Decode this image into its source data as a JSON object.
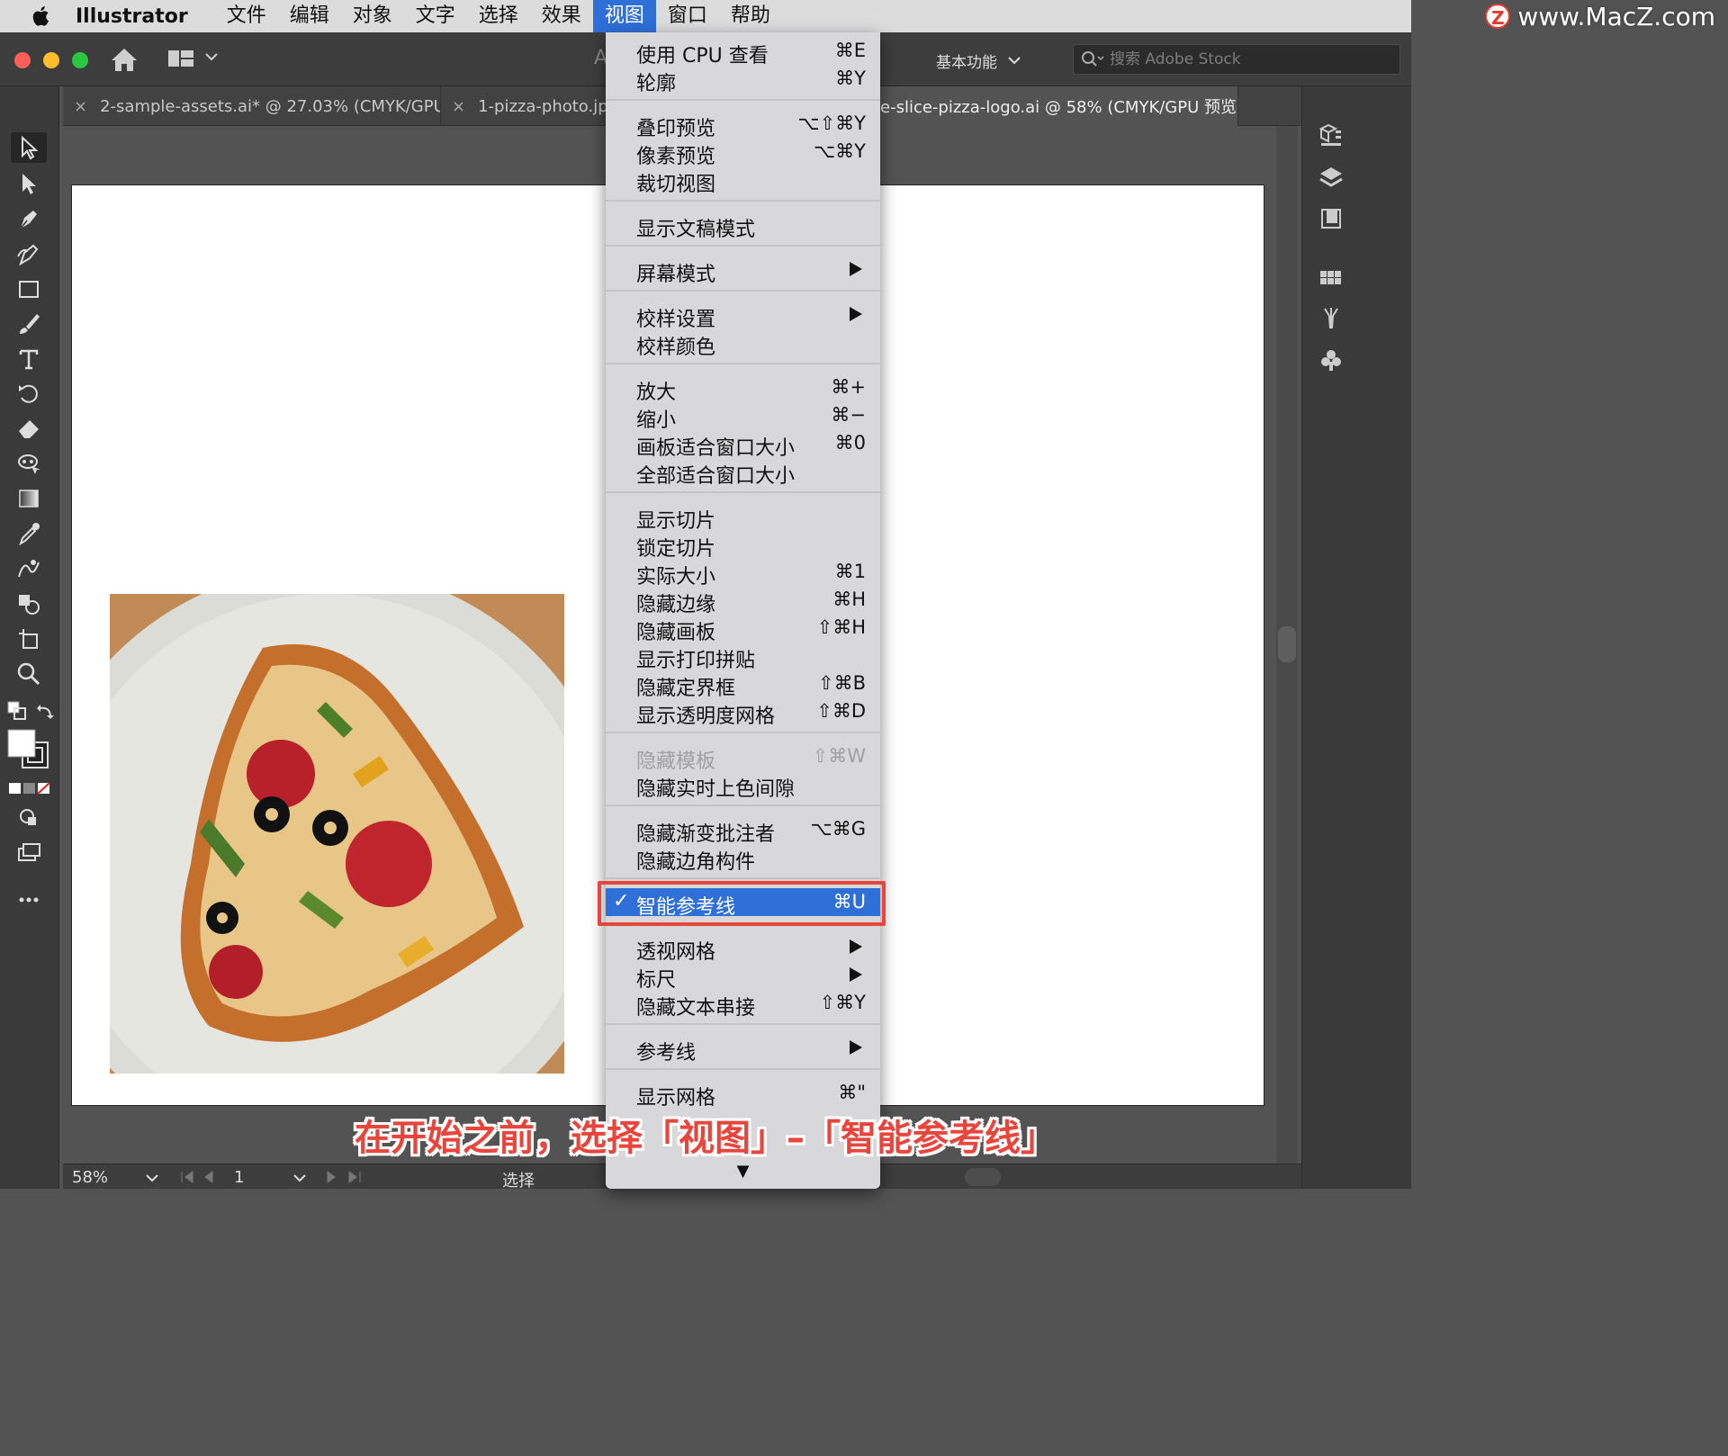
{
  "menubar": {
    "app_name": "Illustrator",
    "items": [
      "文件",
      "编辑",
      "对象",
      "文字",
      "选择",
      "效果",
      "视图",
      "窗口",
      "帮助"
    ],
    "active_index": 6
  },
  "watermark": {
    "letter": "Z",
    "url": "www.MacZ.com"
  },
  "appbar": {
    "workspace": "基本功能",
    "search_placeholder": "搜索 Adobe Stock",
    "partial_title": "A"
  },
  "tabs": [
    {
      "label": "2-sample-assets.ai* @ 27.03% (CMYK/GPU..."
    },
    {
      "label": "1-pizza-photo.jpg"
    },
    {
      "label": "e-slice-pizza-logo.ai @ 58% (CMYK/GPU 预览)"
    }
  ],
  "view_menu": {
    "groups": [
      [
        {
          "label": "使用 CPU 查看",
          "shortcut": "⌘E"
        },
        {
          "label": "轮廓",
          "shortcut": "⌘Y"
        }
      ],
      [
        {
          "label": "叠印预览",
          "shortcut": "⌥⇧⌘Y"
        },
        {
          "label": "像素预览",
          "shortcut": "⌥⌘Y"
        },
        {
          "label": "裁切视图",
          "shortcut": ""
        }
      ],
      [
        {
          "label": "显示文稿模式",
          "shortcut": ""
        }
      ],
      [
        {
          "label": "屏幕模式",
          "shortcut": "",
          "submenu": true
        }
      ],
      [
        {
          "label": "校样设置",
          "shortcut": "",
          "submenu": true
        },
        {
          "label": "校样颜色",
          "shortcut": ""
        }
      ],
      [
        {
          "label": "放大",
          "shortcut": "⌘+"
        },
        {
          "label": "缩小",
          "shortcut": "⌘−"
        },
        {
          "label": "画板适合窗口大小",
          "shortcut": "⌘0"
        },
        {
          "label": "全部适合窗口大小",
          "shortcut": ""
        }
      ],
      [
        {
          "label": "显示切片",
          "shortcut": ""
        },
        {
          "label": "锁定切片",
          "shortcut": ""
        },
        {
          "label": "实际大小",
          "shortcut": "⌘1"
        },
        {
          "label": "隐藏边缘",
          "shortcut": "⌘H"
        },
        {
          "label": "隐藏画板",
          "shortcut": "⇧⌘H"
        },
        {
          "label": "显示打印拼贴",
          "shortcut": ""
        },
        {
          "label": "隐藏定界框",
          "shortcut": "⇧⌘B"
        },
        {
          "label": "显示透明度网格",
          "shortcut": "⇧⌘D"
        }
      ],
      [
        {
          "label": "隐藏模板",
          "shortcut": "⇧⌘W",
          "disabled": true
        },
        {
          "label": "隐藏实时上色间隙",
          "shortcut": ""
        }
      ],
      [
        {
          "label": "隐藏渐变批注者",
          "shortcut": "⌥⌘G"
        },
        {
          "label": "隐藏边角构件",
          "shortcut": ""
        }
      ],
      [
        {
          "label": "智能参考线",
          "shortcut": "⌘U",
          "checked": true,
          "highlighted": true
        }
      ],
      [
        {
          "label": "透视网格",
          "shortcut": "",
          "submenu": true
        },
        {
          "label": "标尺",
          "shortcut": "",
          "submenu": true
        },
        {
          "label": "隐藏文本串接",
          "shortcut": "⇧⌘Y"
        }
      ],
      [
        {
          "label": "参考线",
          "shortcut": "",
          "submenu": true
        }
      ],
      [
        {
          "label": "显示网格",
          "shortcut": "⌘\""
        }
      ]
    ],
    "check_mark": "✓",
    "more_arrow": "▼"
  },
  "statusbar": {
    "zoom": "58%",
    "page": "1",
    "tool": "选择"
  },
  "caption": "在开始之前，选择「视图」–「智能参考线」",
  "colors": {
    "accent": "#2f6fd8",
    "highlight_box": "#e8463c",
    "ui_dark": "#3a3a3a",
    "canvas": "#535353"
  },
  "toolbar_icons": [
    "selection-tool-icon",
    "direct-selection-tool-icon",
    "pen-tool-icon",
    "curvature-tool-icon",
    "rectangle-tool-icon",
    "paintbrush-tool-icon",
    "type-tool-icon",
    "rotate-tool-icon",
    "eraser-tool-icon",
    "puppet-warp-tool-icon",
    "gradient-tool-icon",
    "eyedropper-tool-icon",
    "blend-tool-icon",
    "shape-builder-tool-icon",
    "artboard-tool-icon",
    "zoom-tool-icon"
  ],
  "rightpanel_icons": [
    "properties-icon",
    "layers-icon",
    "libraries-icon",
    "swatches-icon",
    "brushes-icon",
    "symbols-icon"
  ]
}
